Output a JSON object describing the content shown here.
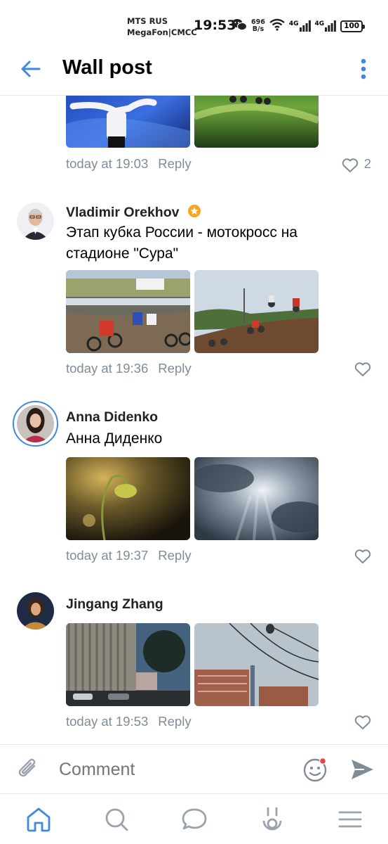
{
  "status_bar": {
    "carrier1": "MTS RUS",
    "carrier2": "MegaFon|CMCC",
    "time": "19:53",
    "net_speed_value": "696",
    "net_speed_unit": "B/s",
    "signal1": "4G",
    "signal2": "4G",
    "battery": "100"
  },
  "header": {
    "title": "Wall post",
    "icons": [
      "back-arrow-icon",
      "more-vertical-icon"
    ]
  },
  "comments": [
    {
      "time": "today at 19:03",
      "reply_label": "Reply",
      "likes": "2",
      "photos": [
        "figure-skating-photo",
        "motocross-race-photo"
      ]
    },
    {
      "author": "Vladimir Orekhov",
      "verified_badge": "star-badge-icon",
      "text": "Этап кубка России - мотокросс на стадионе \"Сура\"",
      "time": "today at 19:36",
      "reply_label": "Reply",
      "photos": [
        "motocross-start-photo",
        "motocross-jump-photo"
      ]
    },
    {
      "author": "Anna Didenko",
      "text": "Анна Диденко",
      "time": "today at 19:37",
      "reply_label": "Reply",
      "photos": [
        "plant-sunlight-photo",
        "cloudy-sky-photo"
      ]
    },
    {
      "author": "Jingang Zhang",
      "time": "today at 19:53",
      "reply_label": "Reply",
      "photos": [
        "building-street-photo",
        "city-wires-photo"
      ]
    }
  ],
  "composer": {
    "placeholder": "Comment",
    "icons": [
      "paperclip-icon",
      "emoji-icon",
      "send-icon"
    ]
  },
  "tabbar": {
    "items": [
      "home-icon",
      "search-icon",
      "messages-icon",
      "clips-icon",
      "menu-icon"
    ]
  },
  "colors": {
    "accent": "#3f8ae0",
    "secondary_text": "#818c99",
    "divider": "#e7e8ec",
    "badge": "#f5a623"
  }
}
